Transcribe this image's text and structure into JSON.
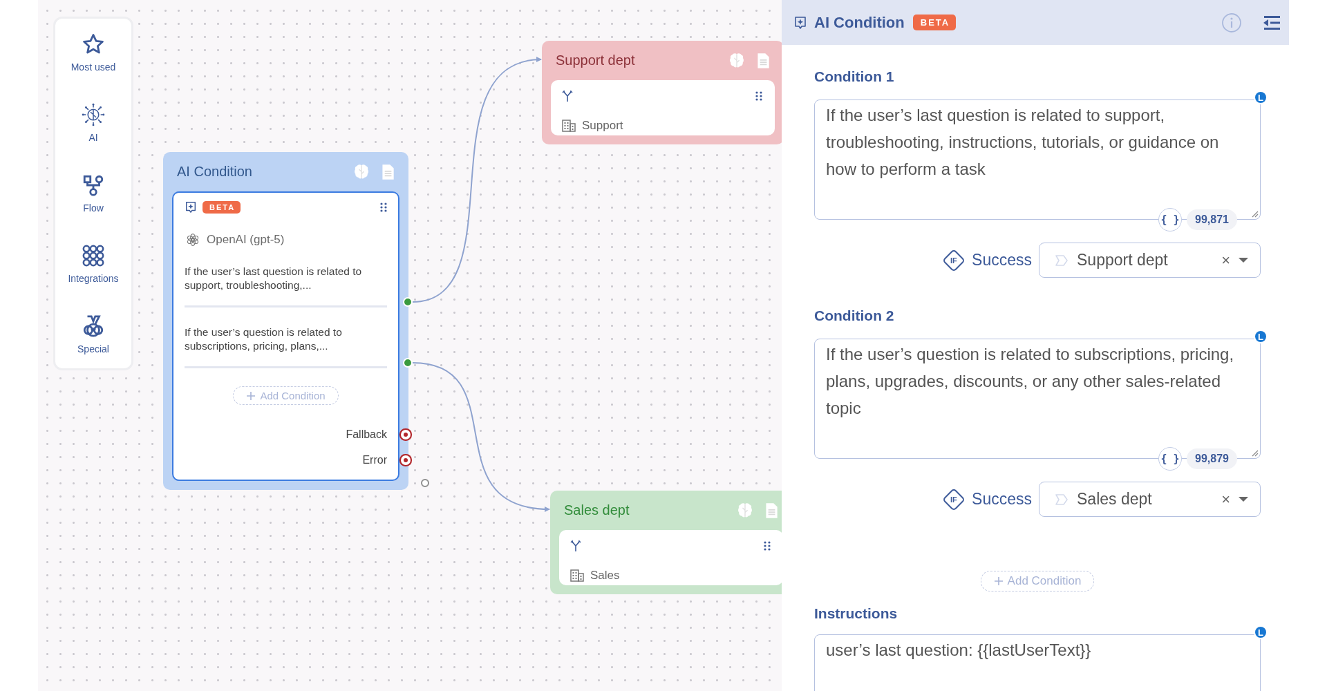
{
  "palette": {
    "items": [
      {
        "label": "Most used"
      },
      {
        "label": "AI"
      },
      {
        "label": "Flow"
      },
      {
        "label": "Integrations"
      },
      {
        "label": "Special"
      }
    ]
  },
  "canvas": {
    "nodes": [
      {
        "kind": "condition",
        "title": "AI Condition",
        "color": "#bcd3f4",
        "selected": true,
        "badge": "BETA",
        "model": "OpenAI (gpt-5)",
        "conditions": [
          {
            "text": "If the user’s last question is related to support, troubleshooting,..."
          },
          {
            "text": "If the user’s question is related to subscriptions, pricing, plans,..."
          }
        ],
        "add_button": "Add Condition",
        "outputs": [
          {
            "label": "Fallback"
          },
          {
            "label": "Error"
          }
        ]
      },
      {
        "kind": "target",
        "title": "Support dept",
        "color": "#f0c0c4",
        "selected": false,
        "label": "Support"
      },
      {
        "kind": "target",
        "title": "Sales dept",
        "color": "#c8e5cb",
        "selected": false,
        "label": "Sales"
      }
    ]
  },
  "panel": {
    "title": "AI Condition",
    "badge": "BETA",
    "conditions": [
      {
        "label": "Condition 1",
        "field_badge": "L",
        "prompt": "If the user’s last question is related to support, troubleshooting, instructions, tutorials, or guidance on how to perform a task",
        "variables_button": "{ }",
        "counter": "99,871",
        "branch_badge": "IF",
        "outcome": "Success",
        "target": "Support dept",
        "clear": "×"
      },
      {
        "label": "Condition 2",
        "field_badge": "L",
        "prompt": "If the user’s question is related to subscriptions, pricing, plans, upgrades, discounts, or any other sales-related topic",
        "variables_button": "{ }",
        "counter": "99,879",
        "branch_badge": "IF",
        "outcome": "Success",
        "target": "Sales dept",
        "clear": "×"
      }
    ],
    "add_button": "Add Condition",
    "instructions": {
      "label": "Instructions",
      "field_badge": "L",
      "prompt": "user’s last question: {{lastUserText}}"
    }
  }
}
